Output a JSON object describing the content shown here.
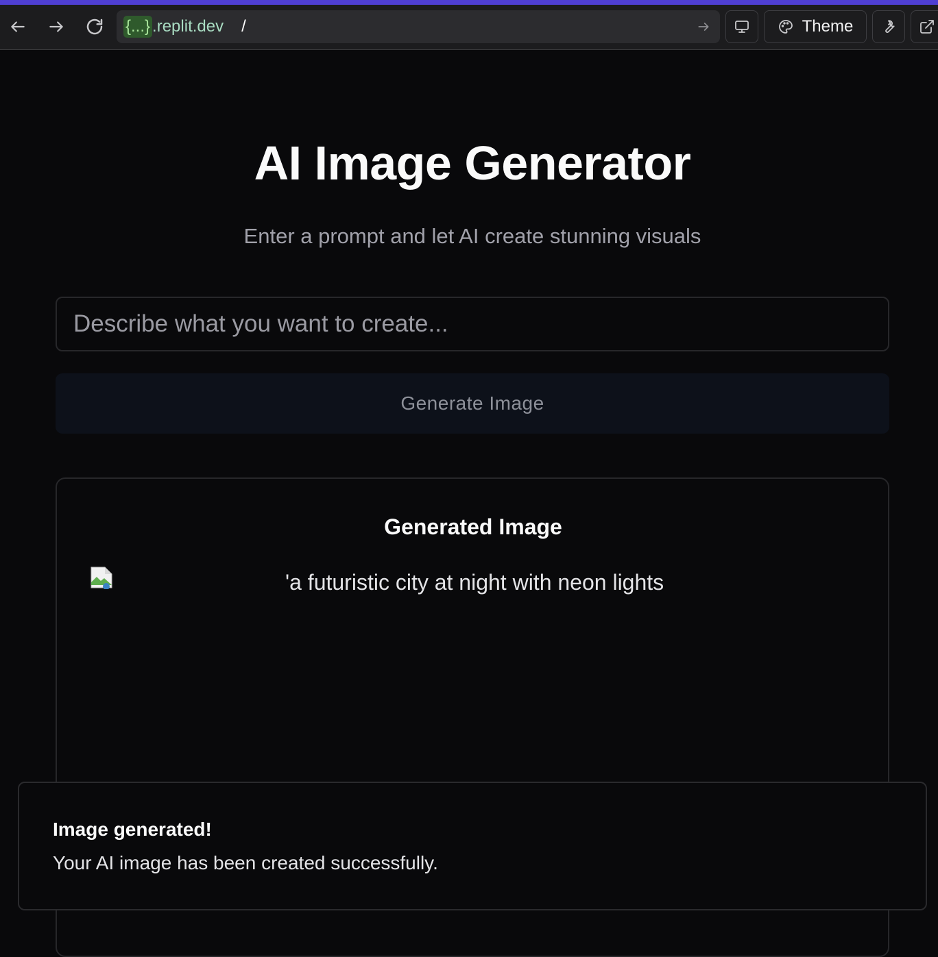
{
  "browser": {
    "url_host_placeholder": "{...}",
    "url_host": ".replit.dev",
    "url_path": "/",
    "theme_label": "Theme"
  },
  "main": {
    "title": "AI Image Generator",
    "subtitle": "Enter a prompt and let AI create stunning visuals",
    "prompt_placeholder": "Describe what you want to create...",
    "prompt_value": "",
    "generate_label": "Generate Image"
  },
  "result": {
    "heading": "Generated Image",
    "image_alt": "'a futuristic city at night with neon lights"
  },
  "toast": {
    "title": "Image generated!",
    "description": "Your AI image has been created successfully."
  },
  "colors": {
    "accent_strip": "#4f3fd3",
    "page_background": "#09090b",
    "button_background": "#0d111a"
  }
}
